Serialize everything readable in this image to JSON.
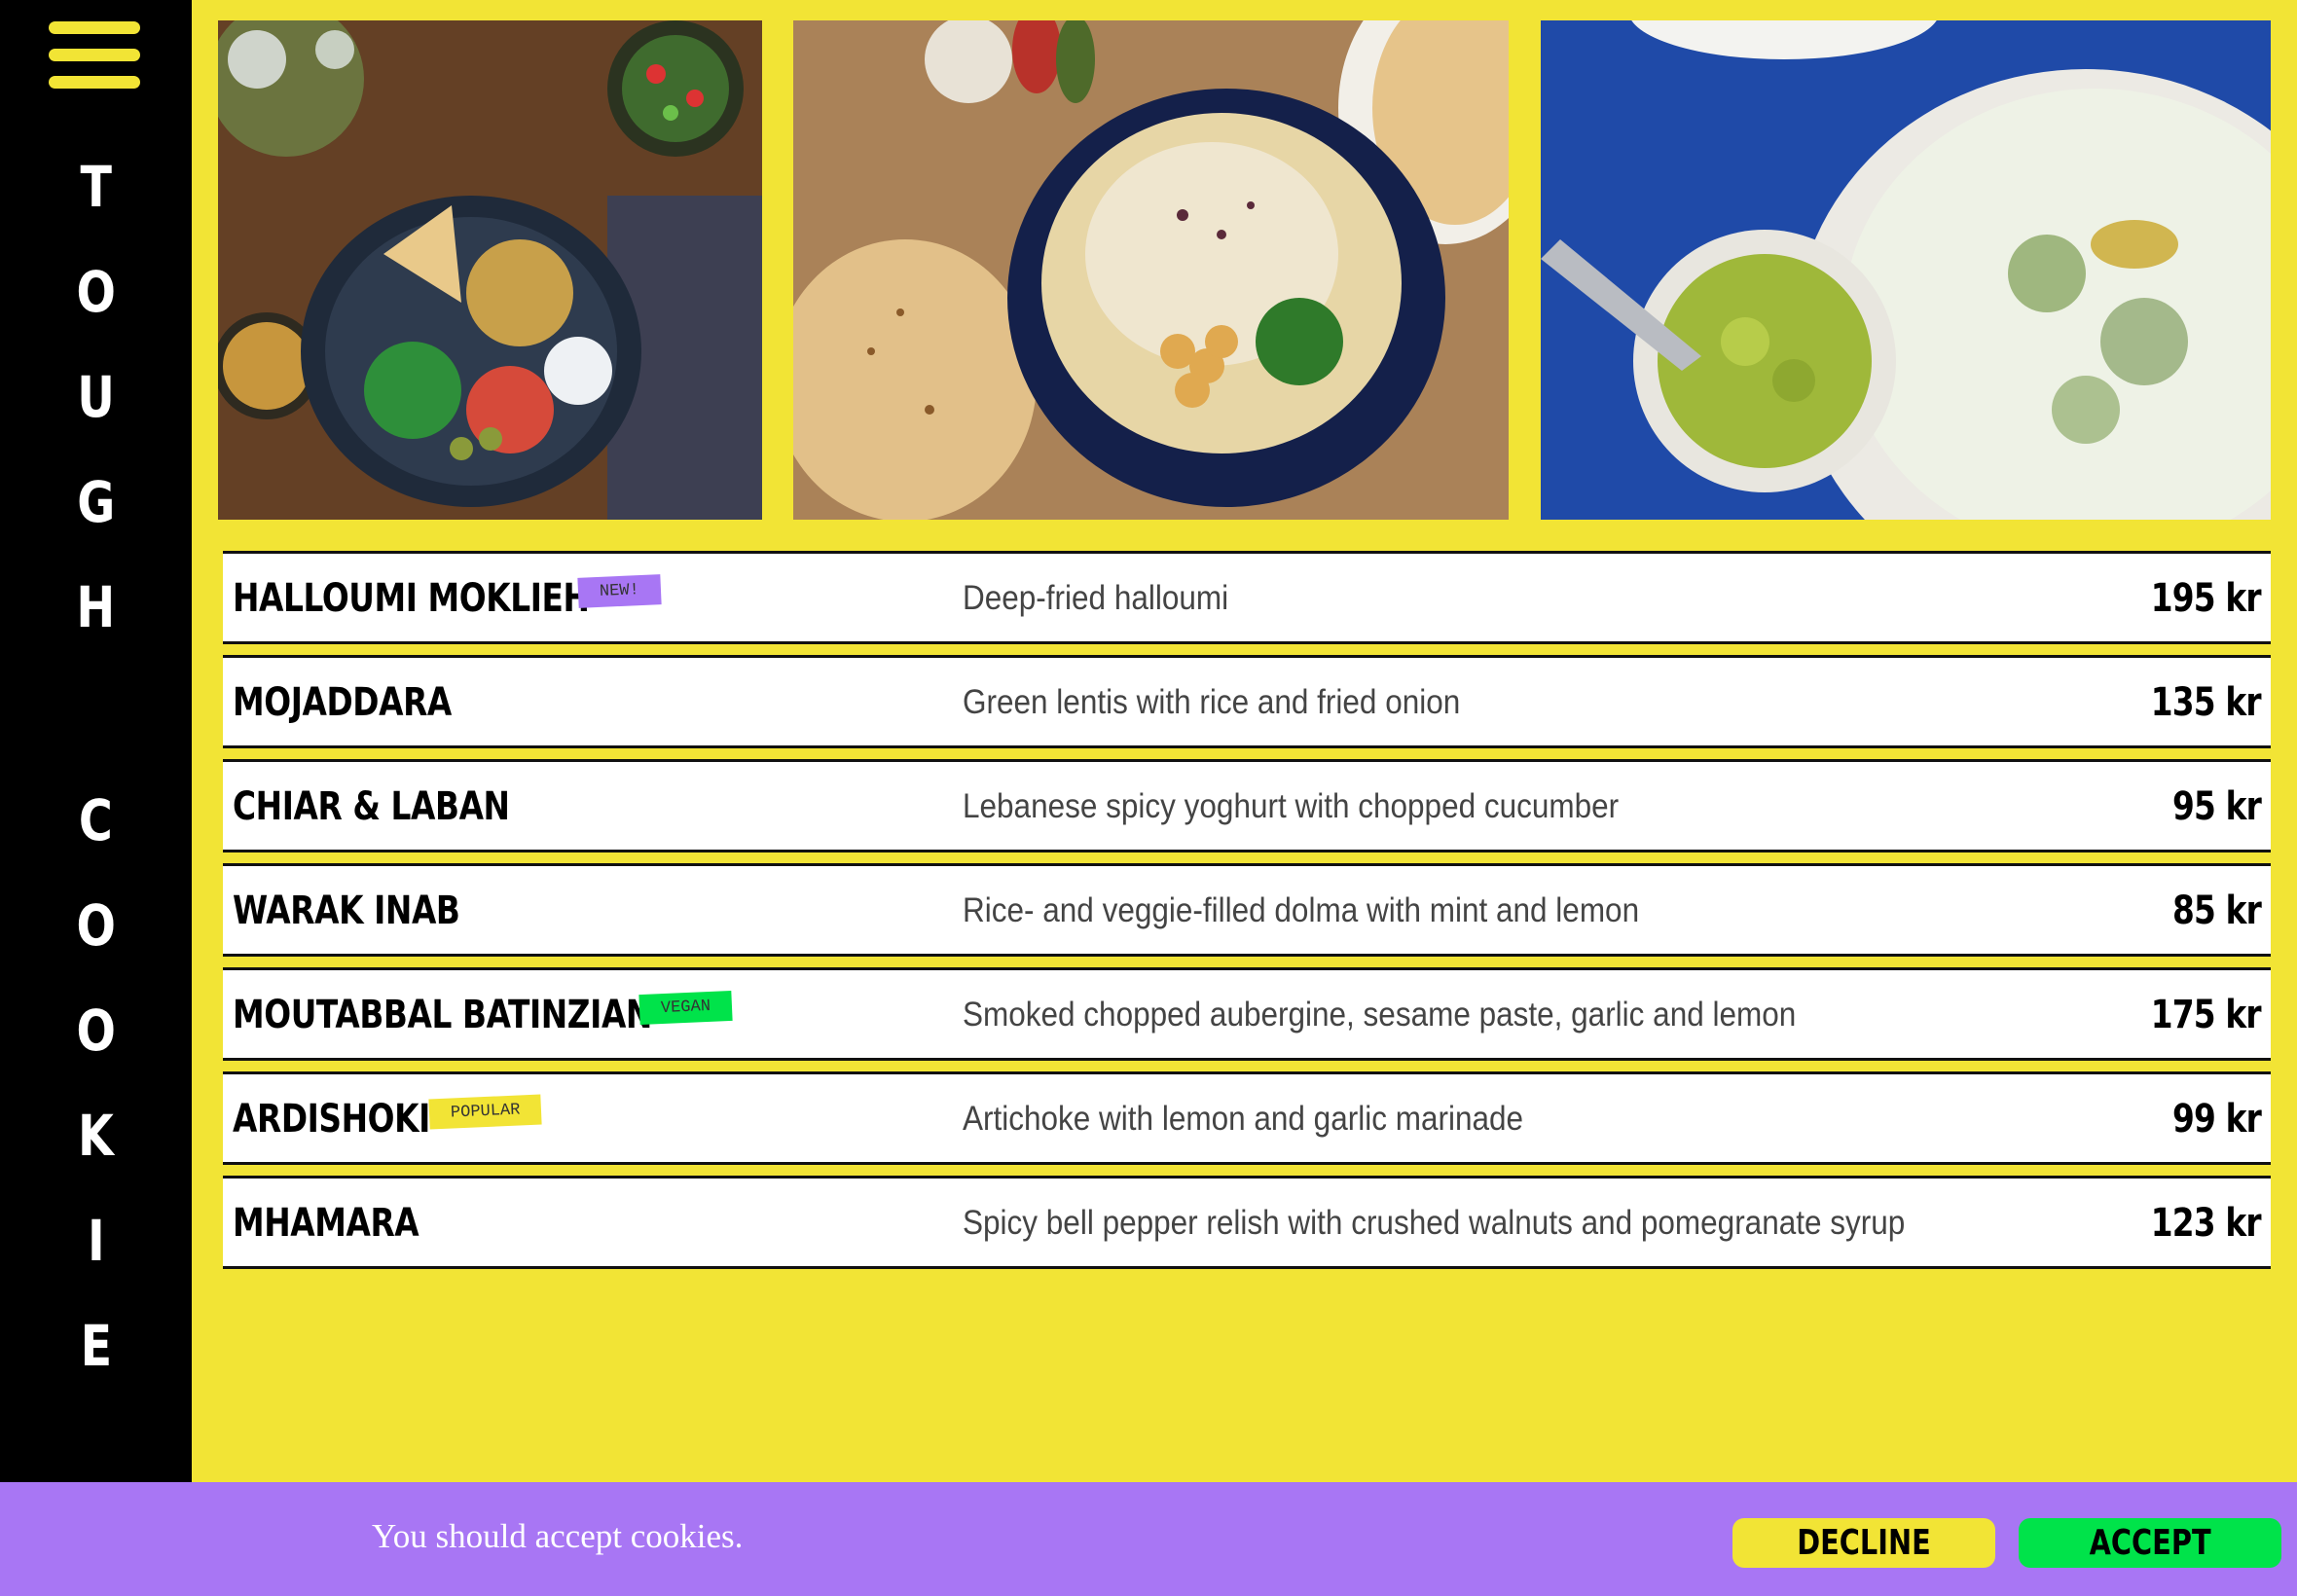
{
  "brand": {
    "word1_letters": [
      "T",
      "O",
      "U",
      "G",
      "H"
    ],
    "word2_letters": [
      "C",
      "O",
      "O",
      "K",
      "I",
      "E"
    ]
  },
  "menu_button_icon": "hamburger-menu-icon",
  "photos": [
    {
      "subject": "salad bowl with chickpeas, olives and vegetables"
    },
    {
      "subject": "hummus bowl with chickpeas and pita bread"
    },
    {
      "subject": "yoghurt cucumber dip and green relish"
    }
  ],
  "menu": [
    {
      "name": "HALLOUMI MOKLIEH",
      "tag": "NEW!",
      "tag_type": "new",
      "description": "Deep-fried halloumi",
      "price": "195 kr"
    },
    {
      "name": "MOJADDARA",
      "tag": "",
      "tag_type": "",
      "description": "Green lentis with rice and fried onion",
      "price": "135 kr"
    },
    {
      "name": "CHIAR & LABAN",
      "tag": "",
      "tag_type": "",
      "description": "Lebanese spicy yoghurt with chopped cucumber",
      "price": "95 kr"
    },
    {
      "name": "WARAK INAB",
      "tag": "",
      "tag_type": "",
      "description": "Rice- and veggie-filled dolma with mint and lemon",
      "price": "85 kr"
    },
    {
      "name": "MOUTABBAL BATINZIAN",
      "tag": "VEGAN",
      "tag_type": "vegan",
      "description": "Smoked chopped aubergine, sesame paste, garlic and lemon",
      "price": "175 kr"
    },
    {
      "name": "ARDISHOKI",
      "tag": "POPULAR",
      "tag_type": "popular",
      "description": "Artichoke with lemon and garlic marinade",
      "price": "99 kr"
    },
    {
      "name": "MHAMARA",
      "tag": "",
      "tag_type": "",
      "description": "Spicy bell pepper relish with crushed walnuts and pomegranate syrup",
      "price": "123 kr"
    }
  ],
  "cookie_banner": {
    "text": "You should accept cookies.",
    "decline_label": "DECLINE",
    "accept_label": "ACCEPT"
  },
  "colors": {
    "background": "#f2e435",
    "sidebar": "#000000",
    "cookie_bar": "#a876f4",
    "accept": "#00e34a",
    "tag_new": "#a876f4",
    "tag_vegan": "#00e34a",
    "tag_popular": "#f2e435"
  }
}
